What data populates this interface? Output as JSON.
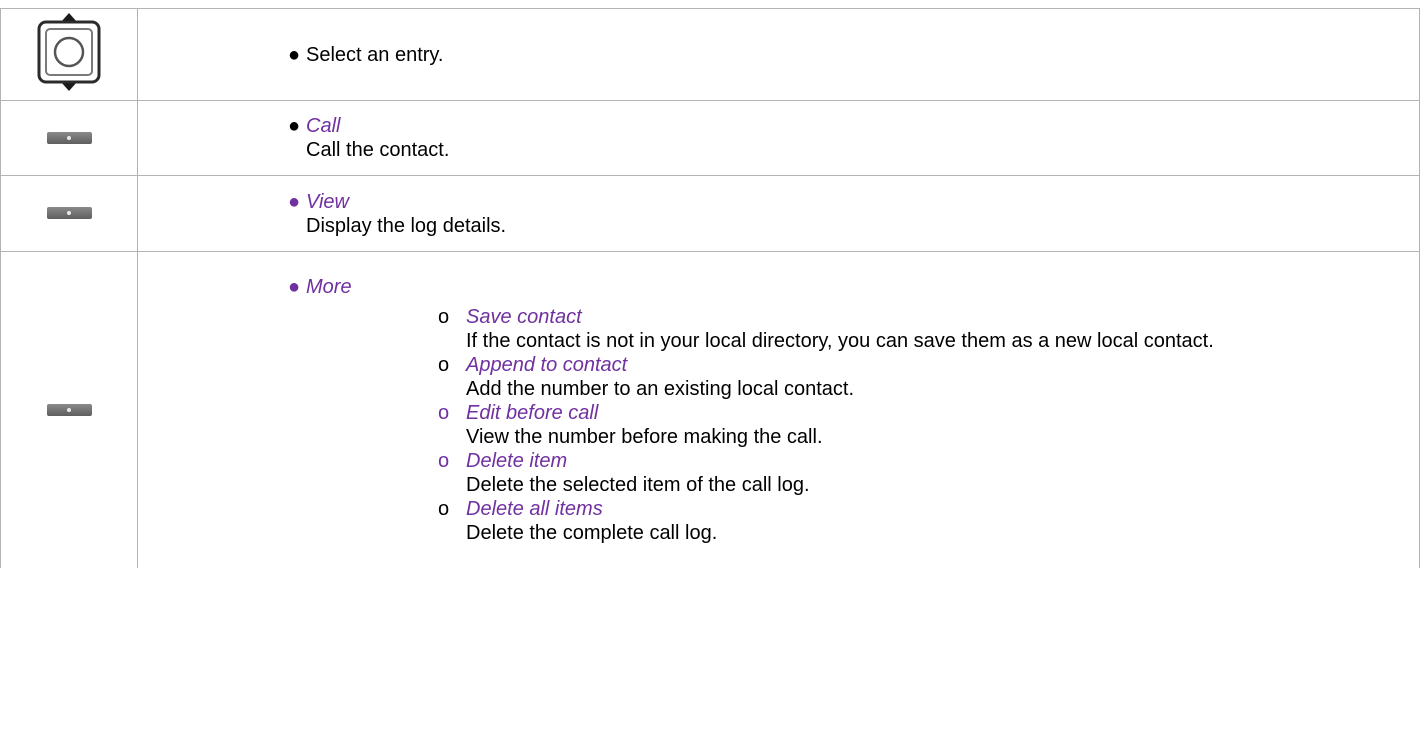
{
  "rows": [
    {
      "icon": "navigation-key-icon",
      "text": "Select an entry."
    },
    {
      "icon": "softkey-icon",
      "action": "Call",
      "description": "Call the contact."
    },
    {
      "icon": "softkey-icon",
      "action": "View",
      "description": "Display the log details."
    },
    {
      "icon": "softkey-icon",
      "action": "More",
      "options": [
        {
          "marker": "o",
          "label": "Save contact",
          "description": "If the contact is not in your local directory, you can save them as a new local contact."
        },
        {
          "marker": "o",
          "label": "Append to contact",
          "description": "Add the number to an existing local contact."
        },
        {
          "marker": "o",
          "label": "Edit before call",
          "description": "View the number before making the call."
        },
        {
          "marker": "o",
          "label": "Delete item",
          "description": "Delete the selected item of the call log."
        },
        {
          "marker": "o",
          "label": "Delete all items",
          "description": "Delete the complete call log."
        }
      ]
    }
  ],
  "colors": {
    "accent": "#7030a0",
    "border": "#b3b3b3",
    "text": "#000000"
  }
}
